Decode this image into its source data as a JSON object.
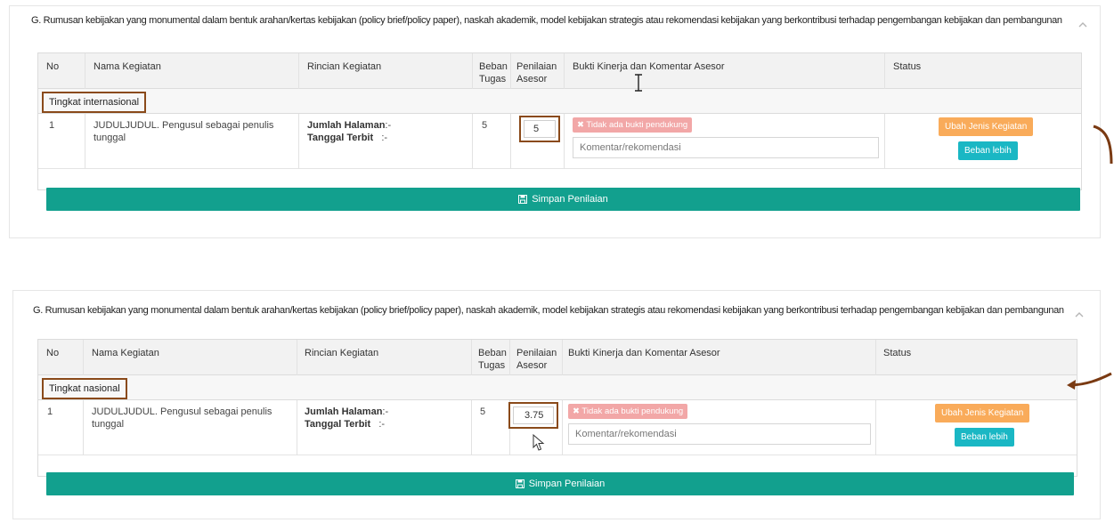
{
  "panels": [
    {
      "title": "G. Rumusan kebijakan yang monumental dalam bentuk arahan/kertas kebijakan (policy brief/policy paper), naskah akademik, model kebijakan strategis atau rekomendasi kebijakan yang berkontribusi terhadap pengembangan kebijakan dan pembangunan",
      "headers": {
        "no": "No",
        "nama": "Nama Kegiatan",
        "rincian": "Rincian Kegiatan",
        "beban_1": "Beban",
        "beban_2": "Tugas",
        "penilaian_1": "Penilaian",
        "penilaian_2": "Asesor",
        "bukti": "Bukti Kinerja dan Komentar Asesor",
        "status": "Status"
      },
      "group": "Tingkat internasional",
      "row": {
        "no": "1",
        "nama_1": "JUDULJUDUL. Pengusul sebagai penulis",
        "nama_2": "tunggal",
        "jumlah_label": "Jumlah Halaman",
        "jumlah_value": ":-",
        "tanggal_label": "Tanggal Terbit",
        "tanggal_value": ":-",
        "beban": "5",
        "score": "5",
        "badge": "✖ Tidak ada bukti pendukung",
        "comment_placeholder": "Komentar/rekomendasi",
        "btn_ubah": "Ubah Jenis Kegiatan",
        "btn_beban": "Beban lebih"
      },
      "save_label": "Simpan Penilaian"
    },
    {
      "title": "G. Rumusan kebijakan yang monumental dalam bentuk arahan/kertas kebijakan (policy brief/policy paper), naskah akademik, model kebijakan strategis atau rekomendasi kebijakan yang berkontribusi terhadap pengembangan kebijakan dan pembangunan",
      "headers": {
        "no": "No",
        "nama": "Nama Kegiatan",
        "rincian": "Rincian Kegiatan",
        "beban_1": "Beban",
        "beban_2": "Tugas",
        "penilaian_1": "Penilaian",
        "penilaian_2": "Asesor",
        "bukti": "Bukti Kinerja dan Komentar Asesor",
        "status": "Status"
      },
      "group": "Tingkat nasional",
      "row": {
        "no": "1",
        "nama_1": "JUDULJUDUL. Pengusul sebagai penulis",
        "nama_2": "tunggal",
        "jumlah_label": "Jumlah Halaman",
        "jumlah_value": ":-",
        "tanggal_label": "Tanggal Terbit",
        "tanggal_value": ":-",
        "beban": "5",
        "score": "3.75",
        "badge": "✖ Tidak ada bukti pendukung",
        "comment_placeholder": "Komentar/rekomendasi",
        "btn_ubah": "Ubah Jenis Kegiatan",
        "btn_beban": "Beban lebih"
      },
      "save_label": "Simpan Penilaian"
    }
  ],
  "colors": {
    "highlight_border": "#8a4a1a",
    "save_bar": "#12a08e",
    "btn_orange": "#f9ab5a",
    "btn_teal": "#1ab7c4",
    "badge_red": "#f2a7a7"
  },
  "icons": [
    "chevron-up-icon",
    "save-icon",
    "close-icon",
    "arrow-icon",
    "text-cursor-icon",
    "mouse-pointer-icon"
  ]
}
